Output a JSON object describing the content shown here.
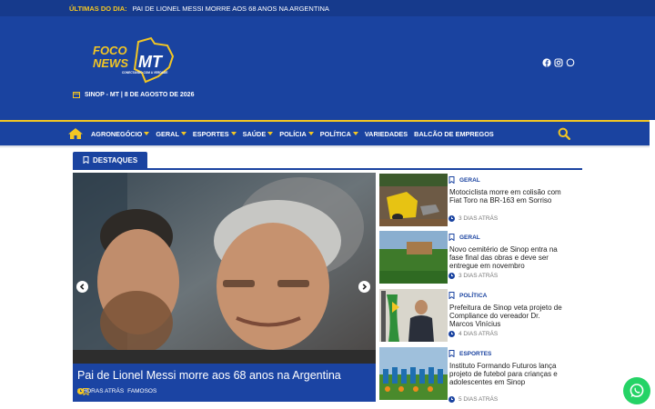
{
  "topbar": {
    "label": "ÚLTIMAS DO DIA:",
    "headline": "PAI DE LIONEL MESSI MORRE AOS 68 ANOS NA ARGENTINA"
  },
  "logo": {
    "alt": "Foco News MT",
    "tagline": "CONECTANDO COM A VERDADE"
  },
  "header": {
    "date": "SINOP - MT | 8 DE AGOSTO DE 2026"
  },
  "social": [
    "facebook-icon",
    "instagram-icon",
    "whatsapp-icon"
  ],
  "nav": {
    "items": [
      {
        "label": "AGRONEGÓCIO",
        "dropdown": true
      },
      {
        "label": "GERAL",
        "dropdown": true
      },
      {
        "label": "ESPORTES",
        "dropdown": true
      },
      {
        "label": "SAÚDE",
        "dropdown": true
      },
      {
        "label": "POLÍCIA",
        "dropdown": true
      },
      {
        "label": "POLÍTICA",
        "dropdown": true
      },
      {
        "label": "VARIEDADES",
        "dropdown": false
      },
      {
        "label": "BALCÃO DE EMPREGOS",
        "dropdown": false
      }
    ]
  },
  "section": {
    "title": "DESTAQUES"
  },
  "hero": {
    "title": "Pai de Lionel Messi morre aos 68 anos na Argentina",
    "time": "2 HORAS ATRÁS",
    "category": "FAMOSOS"
  },
  "cards": [
    {
      "category": "GERAL",
      "title": "Motociclista morre em colisão com Fiat Toro na BR-163 em Sorriso",
      "time": "3 DIAS ATRÁS"
    },
    {
      "category": "GERAL",
      "title": "Novo cemitério de Sinop entra na fase final das obras e deve ser entregue em novembro",
      "time": "3 DIAS ATRÁS"
    },
    {
      "category": "POLÍTICA",
      "title": "Prefeitura de Sinop veta projeto de Compliance do vereador Dr. Marcos Vinícius",
      "time": "4 DIAS ATRÁS"
    },
    {
      "category": "ESPORTES",
      "title": "Instituto Formando Futuros lança projeto de futebol para crianças e adolescentes em Sinop",
      "time": "5 DIAS ATRÁS"
    }
  ],
  "colors": {
    "brand_blue": "#1a43a0",
    "accent_yellow": "#f3c623",
    "whatsapp_green": "#25d366"
  }
}
